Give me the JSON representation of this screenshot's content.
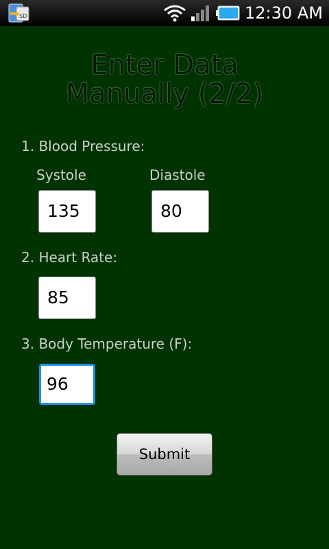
{
  "status_bar": {
    "time": "12:30 AM",
    "icons": [
      "sd-card-icon",
      "wifi-icon",
      "signal-icon",
      "battery-icon"
    ]
  },
  "title": {
    "line1": "Enter Data",
    "line2": "Manually (2/2)"
  },
  "form": {
    "blood_pressure": {
      "label": "1. Blood Pressure:",
      "systole_label": "Systole",
      "systole_value": "135",
      "diastole_label": "Diastole",
      "diastole_value": "80"
    },
    "heart_rate": {
      "label": "2. Heart Rate:",
      "value": "85"
    },
    "body_temperature": {
      "label": "3. Body Temperature (F):",
      "value": "96"
    },
    "submit_label": "Submit"
  },
  "colors": {
    "background": "#003300",
    "focus_border": "#1e90e6"
  }
}
